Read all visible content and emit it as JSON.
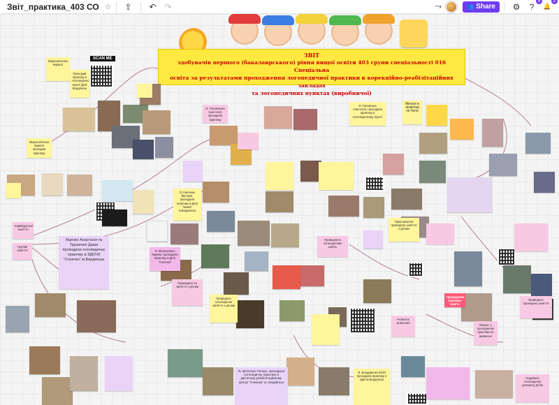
{
  "topbar": {
    "title": "Звіт_практика_403 СО",
    "star": "☆",
    "upload": "⇪",
    "undo": "↶",
    "redo": "↷",
    "cursor_tool": "⤳",
    "share_icon": "👥",
    "share_label": "Share",
    "settings_icon": "⚙",
    "help_icon": "?",
    "help_badge": "9",
    "bell_icon": "🔔",
    "bell_badge": "2"
  },
  "board": {
    "title_line1": "ЗВІТ",
    "title_line2": "здобувачів першого (бакалаврського) рівня вищої освіти 403 групи спеціальності 016 Спеціальна",
    "title_line3": "освіта за результатами проходження логопедичної практики в корекційно-реабілітаційних закладах",
    "title_line4": "та логопедичних пунктах (виробничої)",
    "scan_label": "SCAN ME"
  },
  "notes": [
    {
      "id": "n1",
      "text": "Мирошніченко Кирило",
      "color": "#fff59a"
    },
    {
      "id": "n2",
      "text": "Проходив практику в логопедичному пункті ДНЗ Бердянськ",
      "color": "#fff59a"
    },
    {
      "id": "n3",
      "text": "Мирошніченко Кирило проходив практику",
      "color": "#fff59a"
    },
    {
      "id": "n4",
      "text": "Групові заняття",
      "color": "#f8c9e4"
    },
    {
      "id": "n5",
      "text": "Яценко Анастасія та Трушенко Даша проходили логопедичну практику в ЗДОЧЗ \"Сонечко\" м.Бердянськ",
      "color": "#e9d4f8"
    },
    {
      "id": "n6",
      "text": "Індивідуальні заняття",
      "color": "#f8c9e4"
    },
    {
      "id": "n7",
      "text": "Я, Каленюк Вікторія, проходила практику в ДНЗ \"Казка\" м.Бердянськ",
      "color": "#fff59a"
    },
    {
      "id": "n8",
      "text": "Я, Москаленко Карина, проходила практику в ДНЗ \"Сонечко\"",
      "color": "#f3b8ea"
    },
    {
      "id": "n9",
      "text": "Приходили на заняття з дітьми",
      "color": "#f8c9e4"
    },
    {
      "id": "n10",
      "text": "Проведено логопедичне заняття з дітьми",
      "color": "#fff59a"
    },
    {
      "id": "n11",
      "text": "Я, Головченко Анастасія, проходила практику",
      "color": "#fff59a"
    },
    {
      "id": "n12",
      "text": "Я, Головська Анастасія, проходила практику в логопедичному пункті",
      "color": "#fff59a"
    },
    {
      "id": "n13",
      "text": "Мінуси в практиці не було",
      "color": "#fff59a"
    },
    {
      "id": "n14",
      "text": "Практикантки проводили заняття з дітьми",
      "color": "#fff59a"
    },
    {
      "id": "n15",
      "text": "Проведення логопедичних занять",
      "color": "#f8c9e4"
    },
    {
      "id": "n16",
      "text": "Я, Мінченко Поліна, проходила логопедичну практику в Дитячому реабілітаційному центрі \"Усмішка\" м. Бердянськ",
      "color": "#e9d4f8"
    },
    {
      "id": "n17",
      "text": "Я, Бондаренко Юлія проходила практику в ЗДО м.Бердянськ",
      "color": "#fff59a"
    },
    {
      "id": "n18",
      "text": "Розвиток мовлення",
      "color": "#f8c9e4"
    },
    {
      "id": "n19",
      "text": "Проведення групових занять",
      "color": "#ff5a7a"
    },
    {
      "id": "n20",
      "text": "Проведено проведено заняття",
      "color": "#f8c9e4"
    },
    {
      "id": "n21",
      "text": "Мінуси: у проходженні практики не виявлено",
      "color": "#f8c9e4"
    },
    {
      "id": "n22",
      "text": "Надавала логопедичну допомогу дітям",
      "color": "#f8c9e4"
    }
  ]
}
